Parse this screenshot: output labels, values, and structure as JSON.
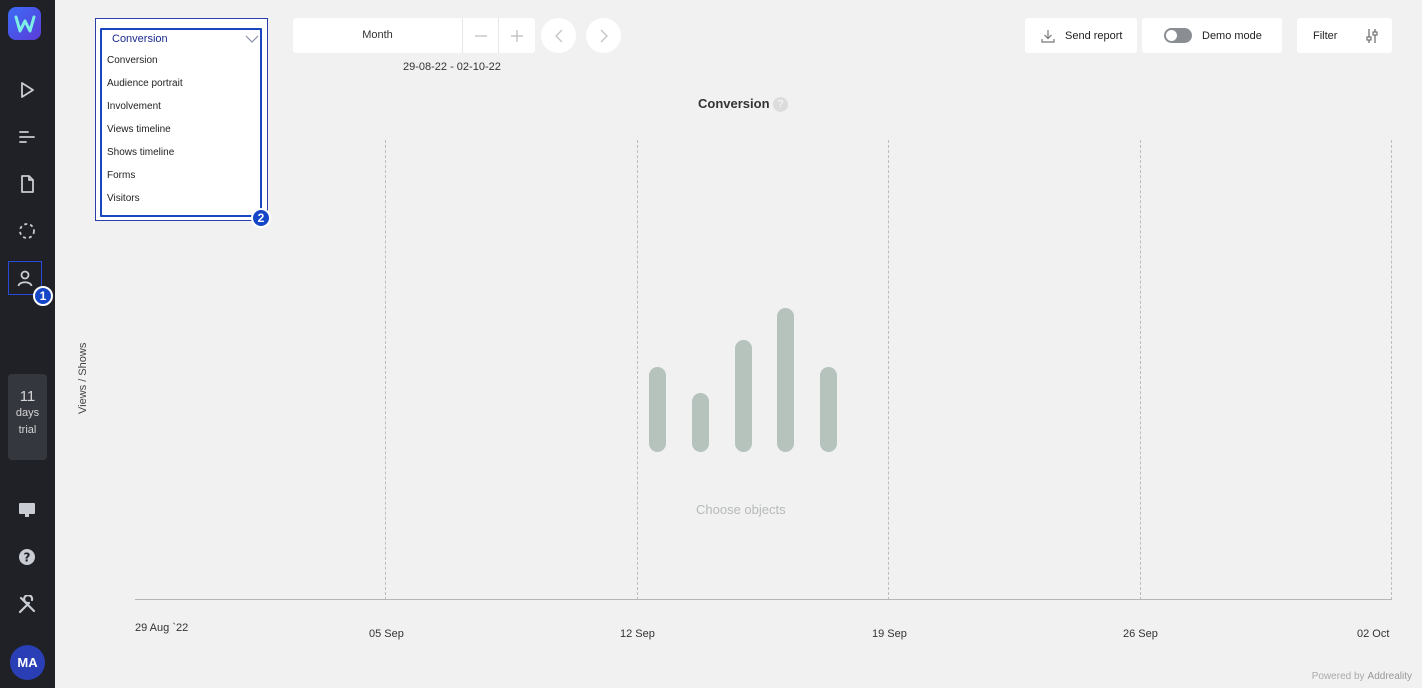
{
  "sidebar": {
    "trial_days": "11",
    "trial_word1": "days",
    "trial_word2": "trial",
    "avatar_initials": "MA",
    "badge1": "1"
  },
  "dropdown": {
    "selected": "Conversion",
    "options": [
      "Conversion",
      "Audience portrait",
      "Involvement",
      "Views timeline",
      "Shows timeline",
      "Forms",
      "Visitors"
    ],
    "badge2": "2"
  },
  "period": {
    "label": "Month",
    "date_range": "29-08-22 - 02-10-22"
  },
  "toolbar": {
    "send_report": "Send report",
    "demo_mode": "Demo mode",
    "filter": "Filter"
  },
  "chart": {
    "title": "Conversion",
    "help": "?",
    "ylabel": "Views / Shows",
    "empty_message": "Choose objects",
    "x_ticks": [
      "29 Aug `22",
      "05 Sep",
      "12 Sep",
      "19 Sep",
      "26 Sep",
      "02 Oct"
    ]
  },
  "footer": {
    "powered_by": "Powered by",
    "brand": "Addreality"
  },
  "colors": {
    "sidebar_bg": "#1f2127",
    "accent": "#1846bf",
    "placeholder_bars": "#b6c3bd"
  }
}
